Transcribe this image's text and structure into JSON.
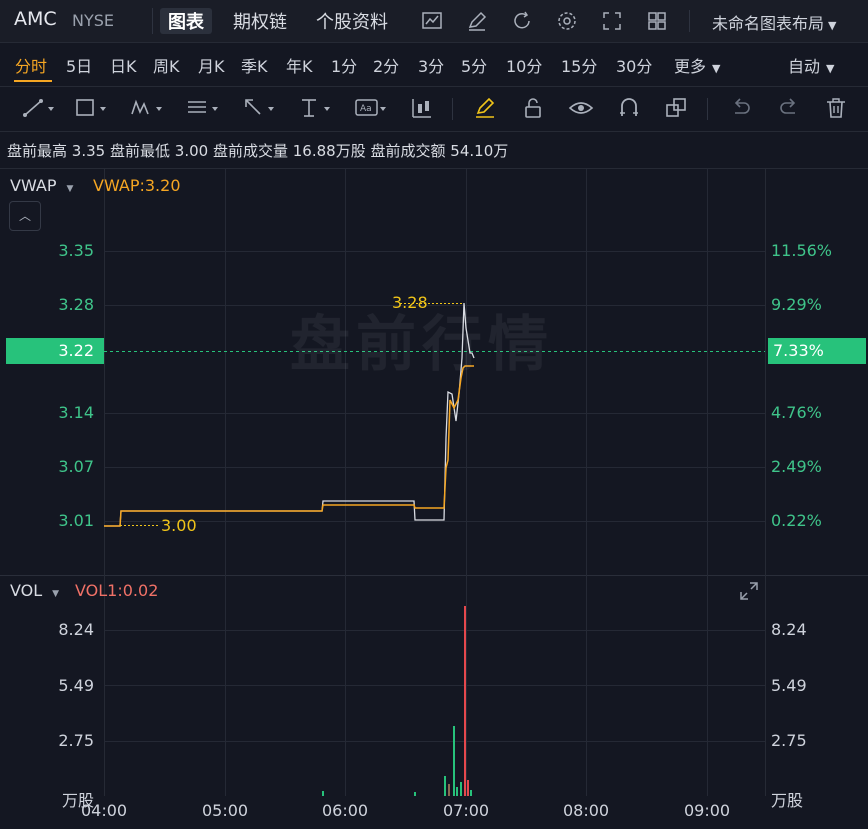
{
  "header": {
    "symbol": "AMC",
    "exchange": "NYSE",
    "tabs": [
      "图表",
      "期权链",
      "个股资料"
    ],
    "layout_name": "未命名图表布局"
  },
  "periods": [
    "分时",
    "5日",
    "日K",
    "周K",
    "月K",
    "季K",
    "年K",
    "1分",
    "2分",
    "3分",
    "5分",
    "10分",
    "15分",
    "30分",
    "更多"
  ],
  "mode": "自动",
  "stats": {
    "premarket_high_label": "盘前最高",
    "premarket_high": "3.35",
    "premarket_low_label": "盘前最低",
    "premarket_low": "3.00",
    "premarket_volume_label": "盘前成交量",
    "premarket_volume": "16.88万股",
    "premarket_amount_label": "盘前成交额",
    "premarket_amount": "54.10万"
  },
  "price_panel": {
    "indicator": "VWAP",
    "indicator_value": "VWAP:3.20",
    "watermark": "盘前行情",
    "current_price": "3.22",
    "current_pct": "7.33%",
    "high_annotation": "3.28",
    "low_annotation": "3.00",
    "left_ticks": [
      "3.35",
      "3.28",
      "3.14",
      "3.07",
      "3.01"
    ],
    "right_ticks": [
      "11.56%",
      "9.29%",
      "4.76%",
      "2.49%",
      "0.22%"
    ]
  },
  "volume_panel": {
    "indicator": "VOL",
    "indicator_value": "VOL1:0.02",
    "left_ticks": [
      "8.24",
      "5.49",
      "2.75"
    ],
    "right_ticks": [
      "8.24",
      "5.49",
      "2.75"
    ],
    "unit": "万股"
  },
  "time_axis": [
    "04:00",
    "05:00",
    "06:00",
    "07:00",
    "08:00",
    "09:00"
  ],
  "colors": {
    "accent": "#f5a623",
    "up": "#27c27b",
    "down": "#e5484d",
    "vwap_line": "#f5a623",
    "price_line": "#d9dce3"
  }
}
